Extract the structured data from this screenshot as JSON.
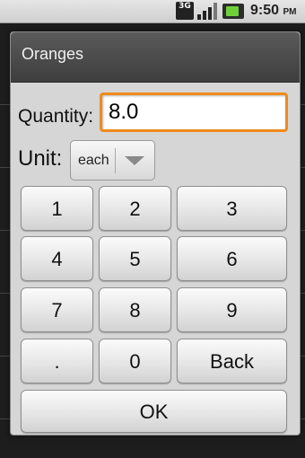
{
  "status_bar": {
    "network": "3G",
    "time": "9:50",
    "ampm": "PM"
  },
  "dialog": {
    "title": "Oranges",
    "quantity_label": "Quantity:",
    "quantity_value": "8.0",
    "unit_label": "Unit:",
    "unit_value": "each",
    "keypad": [
      "1",
      "2",
      "3",
      "4",
      "5",
      "6",
      "7",
      "8",
      "9",
      ".",
      "0",
      "Back"
    ],
    "ok_label": "OK"
  },
  "colors": {
    "accent_focus": "#f08a1c"
  }
}
